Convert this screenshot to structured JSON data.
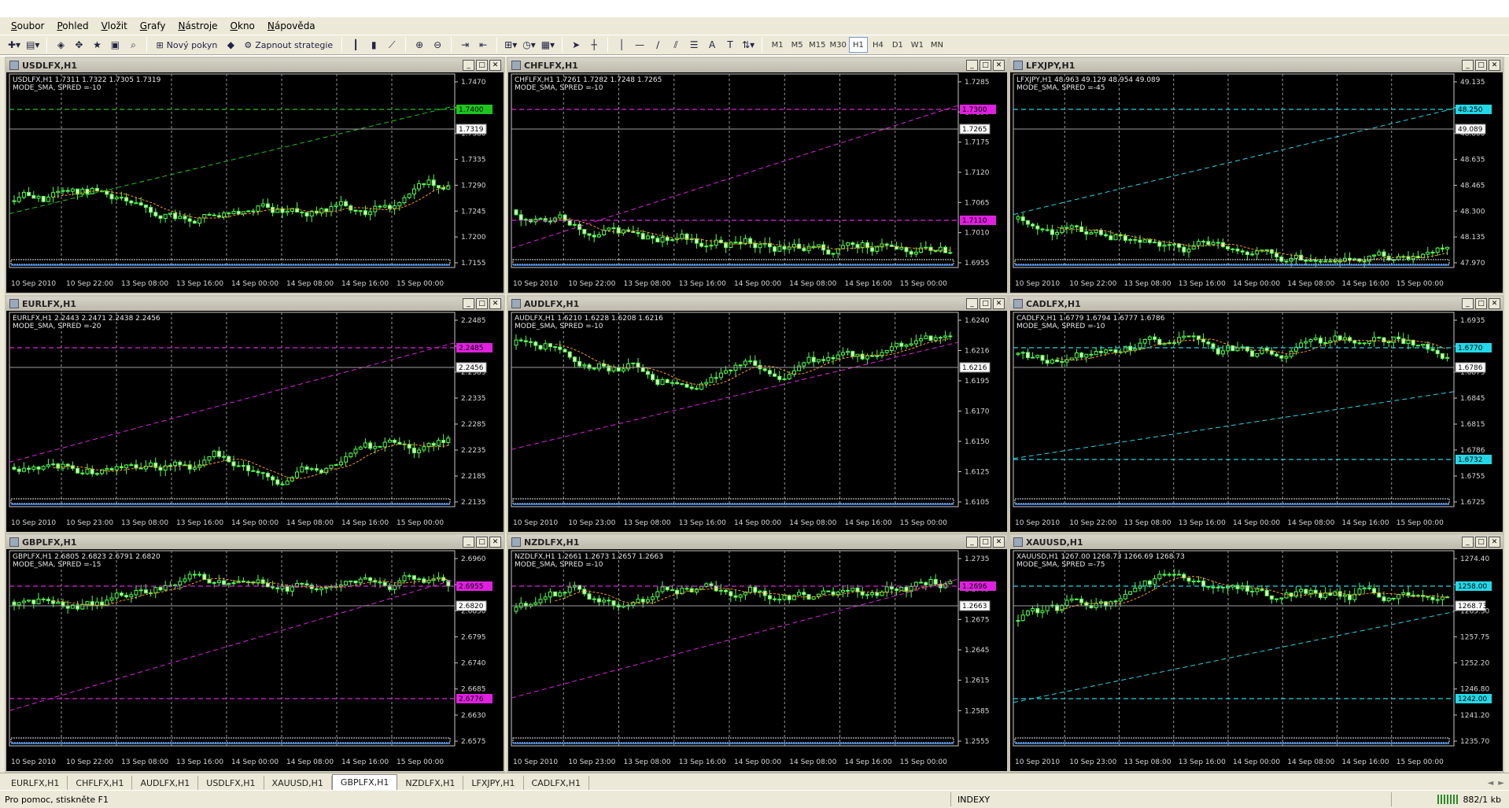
{
  "menu": [
    "Soubor",
    "Pohled",
    "Vložit",
    "Grafy",
    "Nástroje",
    "Okno",
    "Nápověda"
  ],
  "toolbar": {
    "new_order": "Nový pokyn",
    "strategy": "Zapnout strategie",
    "timeframes": [
      "M1",
      "M5",
      "M15",
      "M30",
      "H1",
      "H4",
      "D1",
      "W1",
      "MN"
    ],
    "active_timeframe": "H1"
  },
  "charts": [
    {
      "title": "USDLFX,H1",
      "info_line1": "USDLFX,H1  1.7311 1.7322 1.7305 1.7319",
      "info_line2": "MODE_SMA, SPRED =-10",
      "y_ticks": [
        "1.7470",
        "1.7425",
        "1.7380",
        "1.7335",
        "1.7290",
        "1.7245",
        "1.7200",
        "1.7155"
      ],
      "price_box": "1.7319",
      "level_box": "1.7400",
      "level_color": "#1cc61c",
      "x_ticks": [
        "10 Sep 2010",
        "10 Sep 22:00",
        "13 Sep 08:00",
        "13 Sep 16:00",
        "14 Sep 00:00",
        "14 Sep 08:00",
        "14 Sep 16:00",
        "15 Sep 00:00"
      ]
    },
    {
      "title": "CHFLFX,H1",
      "info_line1": "CHFLFX,H1  1.7261 1.7282 1.7248 1.7265",
      "info_line2": "MODE_SMA, SPRED =-10",
      "y_ticks": [
        "1.7285",
        "1.7230",
        "1.7175",
        "1.7120",
        "1.7065",
        "1.7010",
        "1.6955"
      ],
      "price_box": "1.7265",
      "level_box": "1.7300",
      "level_box2": "1.7110",
      "level_color": "#e020e0",
      "x_ticks": [
        "10 Sep 2010",
        "10 Sep 22:00",
        "13 Sep 08:00",
        "13 Sep 16:00",
        "14 Sep 00:00",
        "14 Sep 08:00",
        "14 Sep 16:00",
        "15 Sep 00:00"
      ]
    },
    {
      "title": "LFXJPY,H1",
      "info_line1": "LFXJPY,H1  48.963 49.129 48.954 49.089",
      "info_line2": "MODE_SMA, SPRED =-45",
      "y_ticks": [
        "49.135",
        "48.970",
        "48.800",
        "48.635",
        "48.465",
        "48.300",
        "48.135",
        "47.970"
      ],
      "price_box": "49.089",
      "level_box": "48.250",
      "level_color": "#22d8e8",
      "x_ticks": [
        "10 Sep 2010",
        "10 Sep 22:00",
        "13 Sep 08:00",
        "13 Sep 16:00",
        "14 Sep 00:00",
        "14 Sep 08:00",
        "14 Sep 16:00",
        "15 Sep 00:00"
      ]
    },
    {
      "title": "EURLFX,H1",
      "info_line1": "EURLFX,H1  2.2443 2.2471 2.2438 2.2456",
      "info_line2": "MODE_SMA, SPRED =-20",
      "y_ticks": [
        "2.2485",
        "2.2435",
        "2.2385",
        "2.2335",
        "2.2285",
        "2.2235",
        "2.2185",
        "2.2135"
      ],
      "price_box": "2.2456",
      "level_box": "2.2485",
      "level_color": "#e020e0",
      "x_ticks": [
        "10 Sep 2010",
        "10 Sep 23:00",
        "13 Sep 08:00",
        "13 Sep 16:00",
        "14 Sep 00:00",
        "14 Sep 08:00",
        "14 Sep 16:00",
        "15 Sep 00:00"
      ]
    },
    {
      "title": "AUDLFX,H1",
      "info_line1": "AUDLFX,H1  1.6210 1.6228 1.6208 1.6216",
      "info_line2": "MODE_SMA, SPRED =-10",
      "y_ticks": [
        "1.6240",
        "1.6216",
        "1.6195",
        "1.6170",
        "1.6150",
        "1.6125",
        "1.6105"
      ],
      "price_box": "1.6216",
      "x_ticks": [
        "10 Sep 2010",
        "10 Sep 23:00",
        "13 Sep 08:00",
        "13 Sep 16:00",
        "14 Sep 00:00",
        "14 Sep 08:00",
        "14 Sep 16:00",
        "15 Sep 00:00"
      ]
    },
    {
      "title": "CADLFX,H1",
      "info_line1": "CADLFX,H1  1.6779 1.6794 1.6777 1.6786",
      "info_line2": "MODE_SMA, SPRED =-10",
      "y_ticks": [
        "1.6935",
        "1.6905",
        "1.6875",
        "1.6845",
        "1.6815",
        "1.6786",
        "1.6755",
        "1.6725"
      ],
      "price_box": "1.6786",
      "level_box": "1.6770",
      "level_box2": "1.6732",
      "level_color": "#22d8e8",
      "x_ticks": [
        "10 Sep 2010",
        "10 Sep 22:00",
        "13 Sep 08:00",
        "13 Sep 16:00",
        "14 Sep 00:00",
        "14 Sep 08:00",
        "14 Sep 16:00",
        "15 Sep 00:00"
      ]
    },
    {
      "title": "GBPLFX,H1",
      "info_line1": "GBPLFX,H1  2.6805 2.6823 2.6791 2.6820",
      "info_line2": "MODE_SMA, SPRED =-15",
      "y_ticks": [
        "2.6960",
        "2.6905",
        "2.6850",
        "2.6795",
        "2.6740",
        "2.6685",
        "2.6630",
        "2.6575"
      ],
      "price_box": "2.6820",
      "level_box": "2.6955",
      "level_box2": "2.6776",
      "level_color": "#e020e0",
      "x_ticks": [
        "10 Sep 2010",
        "10 Sep 22:00",
        "13 Sep 08:00",
        "13 Sep 16:00",
        "14 Sep 00:00",
        "14 Sep 08:00",
        "14 Sep 16:00",
        "15 Sep 00:00"
      ]
    },
    {
      "title": "NZDLFX,H1",
      "info_line1": "NZDLFX,H1  1.2661 1.2673 1.2657 1.2663",
      "info_line2": "MODE_SMA, SPRED =-10",
      "y_ticks": [
        "1.2735",
        "1.2705",
        "1.2675",
        "1.2645",
        "1.2615",
        "1.2585",
        "1.2555"
      ],
      "price_box": "1.2663",
      "level_box": "1.2696",
      "level_color": "#e020e0",
      "x_ticks": [
        "10 Sep 2010",
        "10 Sep 23:00",
        "13 Sep 08:00",
        "13 Sep 16:00",
        "14 Sep 00:00",
        "14 Sep 08:00",
        "14 Sep 16:00",
        "15 Sep 00:00"
      ]
    },
    {
      "title": "XAUUSD,H1",
      "info_line1": "XAUUSD,H1  1267.00 1268.73 1266.69 1268.73",
      "info_line2": "MODE_SMA, SPRED =-75",
      "y_ticks": [
        "1274.40",
        "1268.73",
        "1263.30",
        "1257.75",
        "1252.20",
        "1246.80",
        "1241.20",
        "1235.70"
      ],
      "price_box": "1268.73",
      "level_box": "1258.00",
      "level_box2": "1242.00",
      "level_color": "#22d8e8",
      "x_ticks": [
        "10 Sep 2010",
        "10 Sep 23:00",
        "13 Sep 08:00",
        "13 Sep 16:00",
        "14 Sep 00:00",
        "14 Sep 08:00",
        "14 Sep 16:00",
        "15 Sep 00:00"
      ]
    }
  ],
  "tabs": [
    "EURLFX,H1",
    "CHFLFX,H1",
    "AUDLFX,H1",
    "USDLFX,H1",
    "XAUUSD,H1",
    "GBPLFX,H1",
    "NZDLFX,H1",
    "LFXJPY,H1",
    "CADLFX,H1"
  ],
  "active_tab": "GBPLFX,H1",
  "status": {
    "help": "Pro pomoc, stiskněte F1",
    "profile": "INDEXY",
    "traffic": "882/1 kb"
  }
}
